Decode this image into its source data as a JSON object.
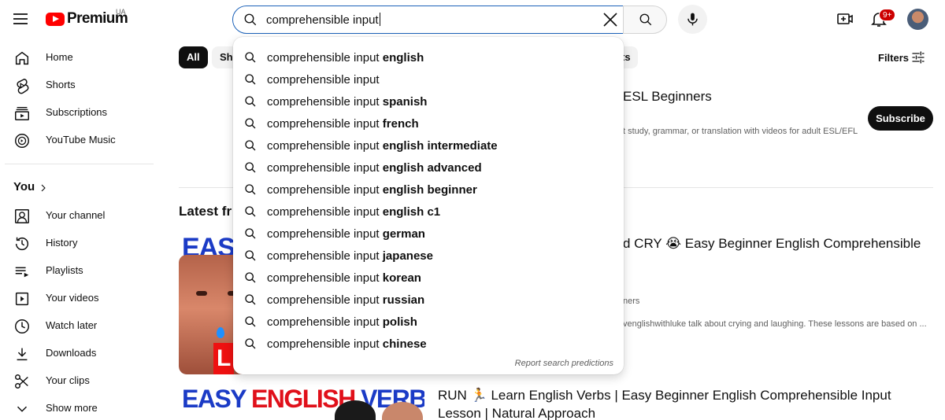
{
  "header": {
    "logo_text": "Premium",
    "country_code": "UA",
    "search_value": "comprehensible input",
    "notification_count": "9+"
  },
  "sidebar": {
    "main_items": [
      {
        "label": "Home",
        "icon": "home-icon"
      },
      {
        "label": "Shorts",
        "icon": "shorts-icon"
      },
      {
        "label": "Subscriptions",
        "icon": "subscriptions-icon"
      },
      {
        "label": "YouTube Music",
        "icon": "music-icon"
      }
    ],
    "you_label": "You",
    "you_items": [
      {
        "label": "Your channel",
        "icon": "channel-icon"
      },
      {
        "label": "History",
        "icon": "history-icon"
      },
      {
        "label": "Playlists",
        "icon": "playlists-icon"
      },
      {
        "label": "Your videos",
        "icon": "videos-icon"
      },
      {
        "label": "Watch later",
        "icon": "watch-later-icon"
      },
      {
        "label": "Downloads",
        "icon": "download-icon"
      },
      {
        "label": "Your clips",
        "icon": "clips-icon"
      },
      {
        "label": "Show more",
        "icon": "chevron-down-icon"
      }
    ]
  },
  "chips": {
    "all": "All",
    "partial_left": "Sh",
    "partial_right": "ts"
  },
  "filters_label": "Filters",
  "channel": {
    "name_visible": "ESL Beginners",
    "description_visible": "t study, grammar, or translation with videos for adult ESL/EFL",
    "subscribe_label": "Subscribe"
  },
  "latest_heading_visible": "Latest fr",
  "video1": {
    "thumb_text": "EASY",
    "thumb_letter": "L",
    "title_visible": "d CRY 😭 Easy Beginner English Comprehensible",
    "meta_visible": "ners",
    "desc_visible": "venglishwithluke talk about crying and laughing. These lessons are based on ..."
  },
  "video2": {
    "thumb_blue": "EASY ",
    "thumb_red": "ENGLISH ",
    "thumb_blue2": "VERBS",
    "title": "RUN 🏃 Learn English Verbs | Easy Beginner English Comprehensible Input Lesson | Natural Approach"
  },
  "suggestions": [
    {
      "base": "comprehensible input",
      "bold": "english"
    },
    {
      "base": "comprehensible input",
      "bold": ""
    },
    {
      "base": "comprehensible input",
      "bold": "spanish"
    },
    {
      "base": "comprehensible input",
      "bold": "french"
    },
    {
      "base": "comprehensible input",
      "bold": "english intermediate"
    },
    {
      "base": "comprehensible input",
      "bold": "english advanced"
    },
    {
      "base": "comprehensible input",
      "bold": "english beginner"
    },
    {
      "base": "comprehensible input",
      "bold": "english c1"
    },
    {
      "base": "comprehensible input",
      "bold": "german"
    },
    {
      "base": "comprehensible input",
      "bold": "japanese"
    },
    {
      "base": "comprehensible input",
      "bold": "korean"
    },
    {
      "base": "comprehensible input",
      "bold": "russian"
    },
    {
      "base": "comprehensible input",
      "bold": "polish"
    },
    {
      "base": "comprehensible input",
      "bold": "chinese"
    }
  ],
  "report_label": "Report search predictions",
  "colors": {
    "brand_red": "#ff0000",
    "search_focus": "#1c62b9",
    "badge_red": "#cc0000"
  }
}
